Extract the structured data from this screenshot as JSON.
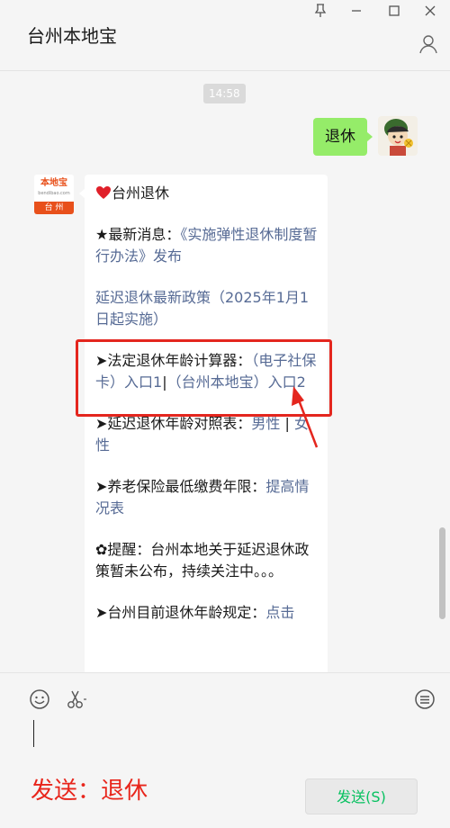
{
  "window": {
    "title": "台州本地宝",
    "pin_icon": "pin-icon",
    "minimize_icon": "minimize-icon",
    "maximize_icon": "maximize-icon",
    "close_icon": "close-icon",
    "profile_icon": "person-icon"
  },
  "chat": {
    "timestamp": "14:58",
    "my_message": "退休",
    "bot_avatar": {
      "line1": "本地宝",
      "line2": "bendibao.com",
      "line3": "台 州"
    },
    "bot_message": {
      "title": "台州退休",
      "heart_icon": "heart-icon",
      "news_prefix": "★最新消息：",
      "news_link": "《实施弹性退休制度暂行办法》发布",
      "delay_link": "延迟退休最新政策（2025年1月1日起实施）",
      "calc_prefix": "➤法定退休年龄计算器：",
      "calc_link1": "（电子社保卡）入口1",
      "calc_sep": "|",
      "calc_link2": "（台州本地宝）入口2",
      "compare_prefix": "➤延迟退休年龄对照表：",
      "compare_male": "男性",
      "compare_sep": " | ",
      "compare_female": "女性",
      "pension_prefix": "➤养老保险最低缴费年限：",
      "pension_link": "提高情况表",
      "reminder": "✿提醒：台州本地关于延迟退休政策暂未公布，持续关注中。。。",
      "current_prefix": "➤台州目前退休年龄规定：",
      "current_link": "点击"
    }
  },
  "input": {
    "emoji_icon": "emoji-icon",
    "scissors_icon": "scissors-icon",
    "chat_history_icon": "chat-history-icon",
    "annotation": "发送：退休",
    "send_button": "发送(S)"
  },
  "colors": {
    "bubble_me": "#95ec69",
    "link": "#576b95",
    "highlight": "#e4261e",
    "annotation": "#e8251b",
    "send_text": "#07c160"
  }
}
